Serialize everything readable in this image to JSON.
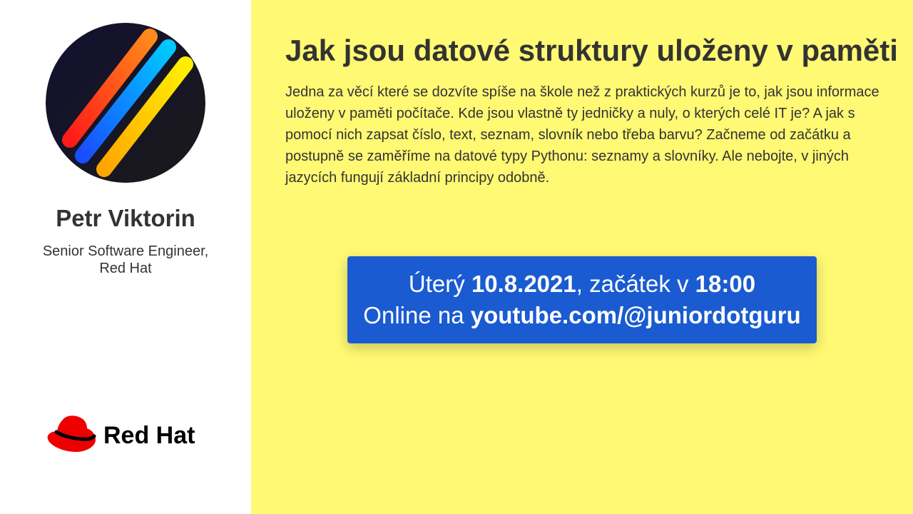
{
  "speaker": {
    "name": "Petr Viktorin",
    "role_line1": "Senior Software Engineer,",
    "role_line2": "Red Hat"
  },
  "company_logo": {
    "text": "Red Hat",
    "hat_color": "#ee0000"
  },
  "talk": {
    "title": "Jak jsou datové struktury uloženy v paměti",
    "abstract": "Jedna za věcí které se dozvíte spíše na škole než z praktických kurzů je to, jak jsou informace uloženy v paměti počítače. Kde jsou vlastně ty jedničky a nuly, o kterých celé IT je? A jak s pomocí nich zapsat číslo, text, seznam, slovník nebo třeba barvu? Začneme od začátku a postupně se zaměříme na datové typy Pythonu: seznamy a slovníky. Ale nebojte, v jiných jazycích fungují základní principy odobně."
  },
  "event": {
    "day": "Úterý",
    "date": "10.8.2021",
    "start_text": ", začátek v",
    "time": "18:00",
    "online_text": "Online na",
    "url": "youtube.com/@juniordotguru"
  },
  "colors": {
    "sidebar_bg": "#ffffff",
    "main_bg": "#fff974",
    "event_box_bg": "#1a5bd1",
    "text": "#333333"
  }
}
